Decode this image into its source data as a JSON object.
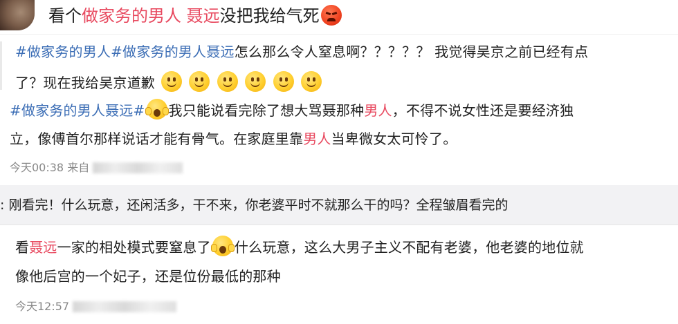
{
  "header": {
    "title_prefix": "看个",
    "title_highlight": "做家务的男人 聂远",
    "title_suffix": "没把我给气死"
  },
  "comment1": {
    "line1_tag": "#做家务的男人#做家务的男人聂远",
    "line1_text": "怎么那么令人窒息啊？？？？？ 我觉得吴京之前已经有点",
    "line2_text": "了？现在我给吴京道歉",
    "smile_count": 6
  },
  "comment2": {
    "tag": "#做家务的男人聂远#",
    "line1_a": "我只能说看完除了想大骂聂那种",
    "line1_hl": "男人",
    "line1_b": "，不得不说女性还是要经济独",
    "line2_a": "立，像傅首尔那样说话才能有骨气。在家庭里靠",
    "line2_hl": "男人",
    "line2_b": "当卑微女太可怜了。"
  },
  "meta1": {
    "time": "今天00:38",
    "source_prefix": "来自"
  },
  "reply": {
    "text": ":  刚看完！什么玩意，还闲活多，干不来，你老婆平时不就那么干的吗？全程皱眉看完的"
  },
  "comment3": {
    "line1_a": "看",
    "line1_hl": "聂远",
    "line1_b": "一家的相处模式要窒息了",
    "line1_c": "什么玩意，这么大男子主义不配有老婆，他老婆的地位就",
    "line2": "像他后宫的一个妃子，还是位份最低的那种"
  },
  "meta2": {
    "time": "今天12:57"
  },
  "colors": {
    "highlight": "#e8495f",
    "tag": "#3b6db5",
    "meta": "#888888"
  },
  "icons": [
    "avatar",
    "angry-face-icon",
    "smile-face-icon",
    "shocked-face-icon"
  ]
}
